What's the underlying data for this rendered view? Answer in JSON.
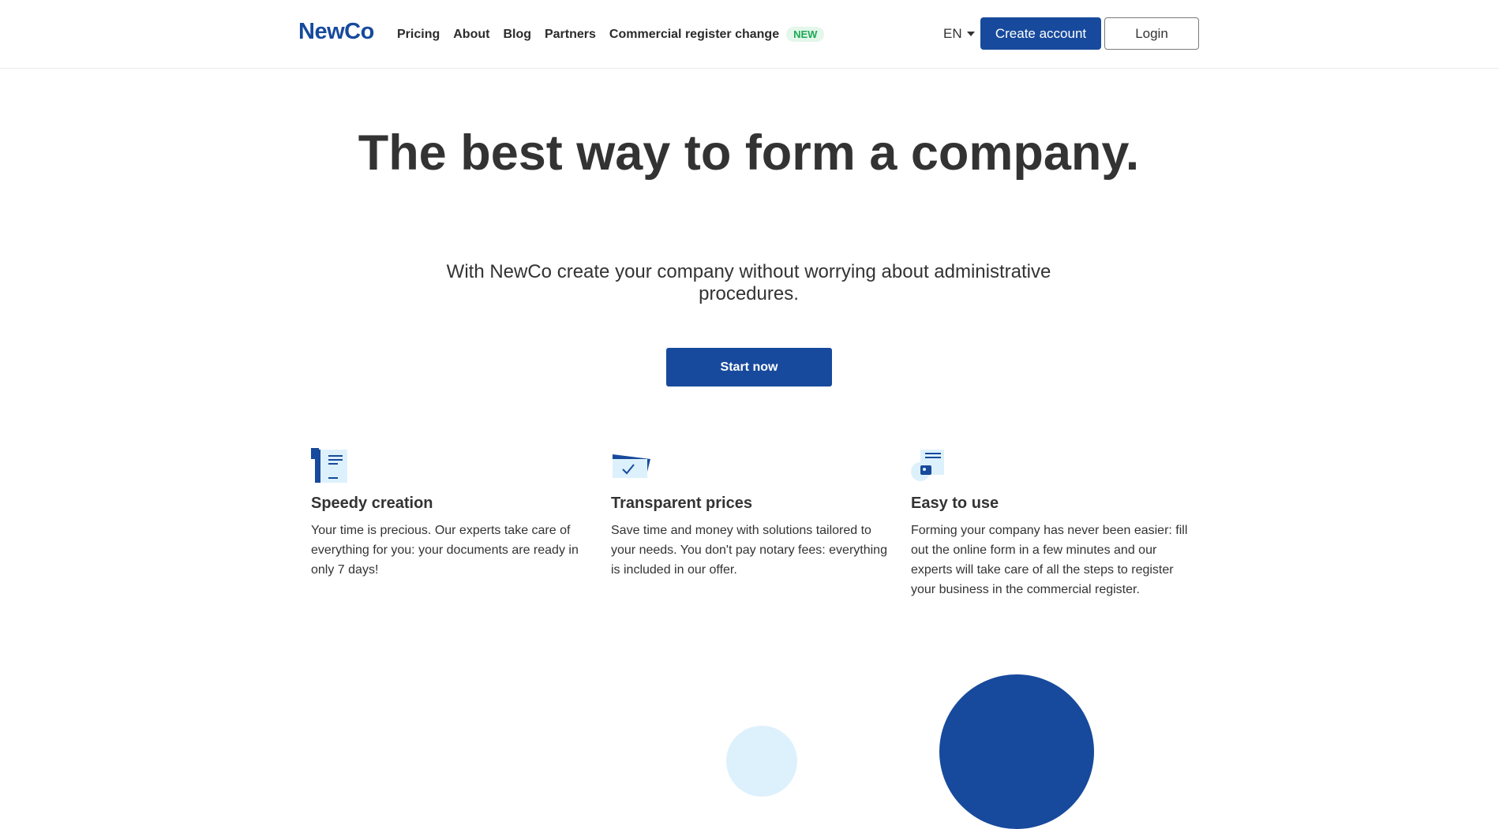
{
  "header": {
    "logo": "NewCo",
    "nav": {
      "pricing": "Pricing",
      "about": "About",
      "blog": "Blog",
      "partners": "Partners",
      "commercial": "Commercial register change",
      "new_badge": "NEW"
    },
    "language": "EN",
    "create_account": "Create account",
    "login": "Login"
  },
  "hero": {
    "title": "The best way to form a company.",
    "subtitle": "With NewCo create your company without worrying about administrative procedures.",
    "cta": "Start now"
  },
  "features": [
    {
      "icon": "document-stack-icon",
      "title": "Speedy creation",
      "text": "Your time is precious. Our experts take care of everything for you: your documents are ready in only 7 days!"
    },
    {
      "icon": "checked-card-icon",
      "title": "Transparent prices",
      "text": "Save time and money with solutions tailored to your needs. You don't pay notary fees: everything is included in our offer."
    },
    {
      "icon": "user-form-icon",
      "title": "Easy to use",
      "text": "Forming your company has never been easier: fill out the online form in a few minutes and our experts will take care of all the steps to register your business in the commercial register."
    }
  ],
  "colors": {
    "brand": "#174a9c",
    "text": "#333333",
    "badge_bg": "#e3f7ea",
    "badge_text": "#1fa855",
    "light_blue": "#ddf1fc"
  }
}
